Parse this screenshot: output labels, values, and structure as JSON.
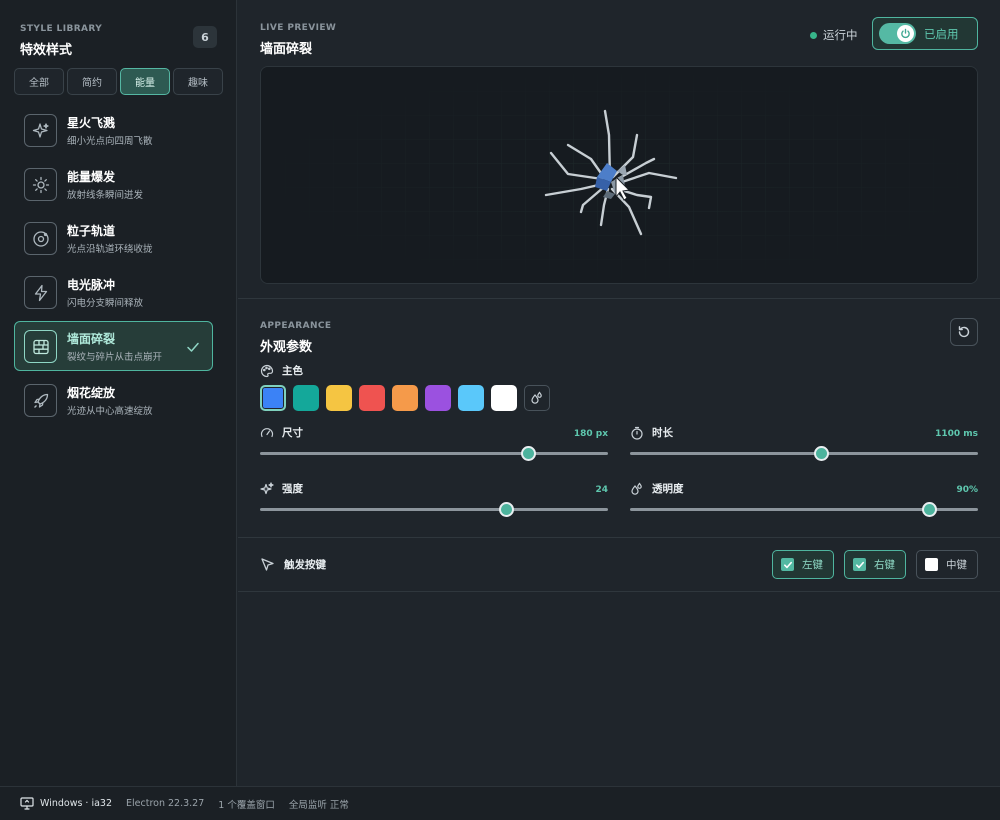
{
  "sidebar": {
    "eyebrow": "STYLE LIBRARY",
    "title": "特效样式",
    "count": "6",
    "filters": [
      "全部",
      "简约",
      "能量",
      "趣味"
    ],
    "active_filter": "能量",
    "effects": [
      {
        "name": "星火飞溅",
        "desc": "细小光点向四周飞散",
        "icon": "sparkles-icon"
      },
      {
        "name": "能量爆发",
        "desc": "放射线条瞬间迸发",
        "icon": "sun-burst-icon"
      },
      {
        "name": "粒子轨道",
        "desc": "光点沿轨道环绕收拢",
        "icon": "orbit-icon"
      },
      {
        "name": "电光脉冲",
        "desc": "闪电分支瞬间释放",
        "icon": "lightning-icon"
      },
      {
        "name": "墙面碎裂",
        "desc": "裂纹与碎片从击点崩开",
        "icon": "brick-wall-icon",
        "selected": true
      },
      {
        "name": "烟花绽放",
        "desc": "光迹从中心高速绽放",
        "icon": "rocket-icon"
      }
    ]
  },
  "preview": {
    "eyebrow": "LIVE PREVIEW",
    "title": "墙面碎裂",
    "status": "运行中",
    "toggle_label": "已启用",
    "enabled": true
  },
  "appearance": {
    "eyebrow": "APPEARANCE",
    "title": "外观参数",
    "color_label": "主色",
    "colors": [
      "#3b82f6",
      "#14a89a",
      "#f5c542",
      "#ef5350",
      "#f59a4a",
      "#9b51e0",
      "#5ac8fa",
      "#ffffff"
    ],
    "selected_color": "#3b82f6",
    "size": {
      "label": "尺寸",
      "value": "180 px",
      "fraction": 0.77
    },
    "duration": {
      "label": "时长",
      "value": "1100 ms",
      "fraction": 0.55
    },
    "intensity": {
      "label": "强度",
      "value": "24",
      "fraction": 0.707
    },
    "opacity": {
      "label": "透明度",
      "value": "90%",
      "fraction": 0.86
    }
  },
  "trigger": {
    "label": "触发按键",
    "buttons": [
      {
        "label": "左键",
        "checked": true
      },
      {
        "label": "右键",
        "checked": true
      },
      {
        "label": "中键",
        "checked": false
      }
    ]
  },
  "footer": {
    "os": "Windows · ia32",
    "electron": "Electron 22.3.27",
    "overlay": "1 个覆盖窗口",
    "monitor": "全局监听 正常"
  },
  "colors": {
    "accent": "#4fb59f",
    "background": "#1f252b",
    "sidebar": "#1b2025"
  }
}
